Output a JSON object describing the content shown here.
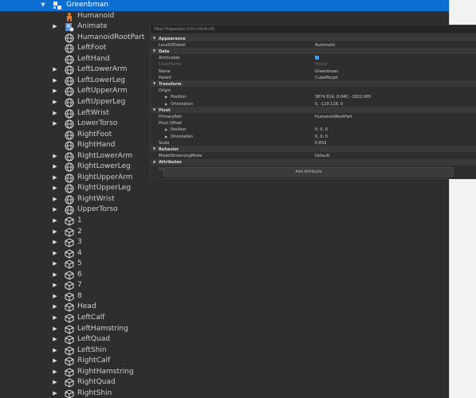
{
  "explorer": {
    "root": {
      "label": "Greenbman"
    },
    "children": [
      {
        "label": "Humanoid",
        "icon": "humanoid-icon",
        "expandable": false
      },
      {
        "label": "Animate",
        "icon": "script-icon",
        "expandable": true
      },
      {
        "label": "HumanoidRootPart",
        "icon": "meshpart-icon",
        "expandable": false
      },
      {
        "label": "LeftFoot",
        "icon": "meshpart-icon",
        "expandable": false
      },
      {
        "label": "LeftHand",
        "icon": "meshpart-icon",
        "expandable": false
      },
      {
        "label": "LeftLowerArm",
        "icon": "meshpart-icon",
        "expandable": true
      },
      {
        "label": "LeftLowerLeg",
        "icon": "meshpart-icon",
        "expandable": true
      },
      {
        "label": "LeftUpperArm",
        "icon": "meshpart-icon",
        "expandable": true
      },
      {
        "label": "LeftUpperLeg",
        "icon": "meshpart-icon",
        "expandable": true
      },
      {
        "label": "LeftWrist",
        "icon": "meshpart-icon",
        "expandable": true
      },
      {
        "label": "LowerTorso",
        "icon": "meshpart-icon",
        "expandable": true
      },
      {
        "label": "RightFoot",
        "icon": "meshpart-icon",
        "expandable": false
      },
      {
        "label": "RightHand",
        "icon": "meshpart-icon",
        "expandable": false
      },
      {
        "label": "RightLowerArm",
        "icon": "meshpart-icon",
        "expandable": true
      },
      {
        "label": "RightLowerLeg",
        "icon": "meshpart-icon",
        "expandable": true
      },
      {
        "label": "RightUpperArm",
        "icon": "meshpart-icon",
        "expandable": true
      },
      {
        "label": "RightUpperLeg",
        "icon": "meshpart-icon",
        "expandable": true
      },
      {
        "label": "RightWrist",
        "icon": "meshpart-icon",
        "expandable": true
      },
      {
        "label": "UpperTorso",
        "icon": "meshpart-icon",
        "expandable": true
      },
      {
        "label": "1",
        "icon": "part-cube-icon",
        "expandable": true
      },
      {
        "label": "2",
        "icon": "part-cube-icon",
        "expandable": true
      },
      {
        "label": "3",
        "icon": "part-cube-icon",
        "expandable": true
      },
      {
        "label": "4",
        "icon": "part-cube-icon",
        "expandable": true
      },
      {
        "label": "5",
        "icon": "part-cube-icon",
        "expandable": true
      },
      {
        "label": "6",
        "icon": "part-cube-icon",
        "expandable": true
      },
      {
        "label": "7",
        "icon": "part-cube-icon",
        "expandable": true
      },
      {
        "label": "8",
        "icon": "part-cube-icon",
        "expandable": true
      },
      {
        "label": "Head",
        "icon": "part-cube-icon",
        "expandable": true
      },
      {
        "label": "LeftCalf",
        "icon": "part-cube-icon",
        "expandable": true
      },
      {
        "label": "LeftHamstring",
        "icon": "part-cube-icon",
        "expandable": true
      },
      {
        "label": "LeftQuad",
        "icon": "part-cube-icon",
        "expandable": true
      },
      {
        "label": "LeftShin",
        "icon": "part-cube-icon",
        "expandable": true
      },
      {
        "label": "RightCalf",
        "icon": "part-cube-icon",
        "expandable": true
      },
      {
        "label": "RightHamstring",
        "icon": "part-cube-icon",
        "expandable": true
      },
      {
        "label": "RightQuad",
        "icon": "part-cube-icon",
        "expandable": true
      },
      {
        "label": "RightShin",
        "icon": "part-cube-icon",
        "expandable": true
      }
    ]
  },
  "properties": {
    "filter_placeholder": "Filter Properties (Ctrl+Shift+P)",
    "rows": [
      {
        "kind": "section",
        "label": "Appearance"
      },
      {
        "kind": "prop",
        "name": "LevelOfDetail",
        "value": "Automatic"
      },
      {
        "kind": "section",
        "label": "Data"
      },
      {
        "kind": "prop",
        "name": "Archivable",
        "value": "",
        "checkbox": true
      },
      {
        "kind": "prop",
        "name": "ClassName",
        "value": "Model",
        "dim": true
      },
      {
        "kind": "prop",
        "name": "Name",
        "value": "Greenbman"
      },
      {
        "kind": "prop",
        "name": "Parent",
        "value": "CubeMorph"
      },
      {
        "kind": "section",
        "label": "Transform"
      },
      {
        "kind": "prop",
        "name": "Origin",
        "value": ""
      },
      {
        "kind": "prop",
        "name": "Position",
        "value": "3874.914, 8.040, -1822.065",
        "caret": true,
        "indent": 2
      },
      {
        "kind": "prop",
        "name": "Orientation",
        "value": "0, -119.118, 0",
        "caret": true,
        "indent": 2
      },
      {
        "kind": "section",
        "label": "Pivot"
      },
      {
        "kind": "prop",
        "name": "PrimaryPart",
        "value": "HumanoidRootPart"
      },
      {
        "kind": "prop",
        "name": "Pivot Offset",
        "value": ""
      },
      {
        "kind": "prop",
        "name": "Position",
        "value": "0, 0, 0",
        "caret": true,
        "indent": 2
      },
      {
        "kind": "prop",
        "name": "Orientation",
        "value": "0, 0, 0",
        "caret": true,
        "indent": 2
      },
      {
        "kind": "prop",
        "name": "Scale",
        "value": "0.853"
      },
      {
        "kind": "section",
        "label": "Behavior"
      },
      {
        "kind": "prop",
        "name": "ModelStreamingMode",
        "value": "Default"
      },
      {
        "kind": "section",
        "label": "Attributes"
      },
      {
        "kind": "prop",
        "name": "No Attributes have been added yet",
        "value": "",
        "dim": true
      }
    ],
    "add_attribute_label": "Add Attribute"
  }
}
